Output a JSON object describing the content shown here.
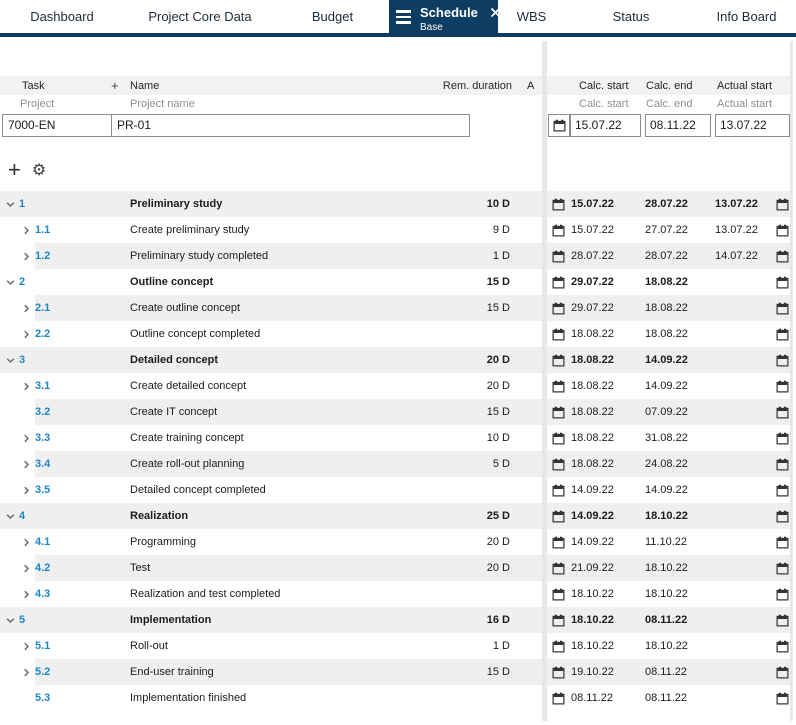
{
  "tabs": [
    {
      "label": "Dashboard"
    },
    {
      "label": "Project Core Data"
    },
    {
      "label": "Budget"
    },
    {
      "label": "Schedule",
      "subtitle": "Base",
      "active": true
    },
    {
      "label": "WBS"
    },
    {
      "label": "Status"
    },
    {
      "label": "Info Board"
    }
  ],
  "colors": {
    "accent_navy": "#0d3d62",
    "link_blue": "#1d87c4",
    "row_stripe": "#efefef",
    "header_bg": "#f2f2f2",
    "panel_separator": "#e8e5ed"
  },
  "icons": {
    "menu-icon": "≡",
    "close-icon": "×",
    "plus-icon": "+",
    "gear-icon": "⚙",
    "calendar-icon": "▦",
    "chevron-down-icon": "∨",
    "chevron-right-icon": "❯"
  },
  "grid": {
    "headers": {
      "task": "Task",
      "plus": "+",
      "name": "Name",
      "rem_duration": "Rem. duration",
      "a": "A",
      "calc_start": "Calc. start",
      "calc_end": "Calc. end",
      "actual_start": "Actual start"
    },
    "filters": {
      "task": "Project",
      "name": "Project name",
      "calc_start": "Calc. start",
      "calc_end": "Calc. end",
      "actual_start": "Actual start"
    },
    "project": {
      "task": "7000-EN",
      "name": "PR-01",
      "calc_start": "15.07.22",
      "calc_end": "08.11.22",
      "actual_start": "13.07.22"
    },
    "rows": [
      {
        "id": "1",
        "name": "Preliminary study",
        "duration": "10 D",
        "calc_start": "15.07.22",
        "calc_end": "28.07.22",
        "actual_start": "13.07.22",
        "level": 0,
        "chevron": "down",
        "bold": true
      },
      {
        "id": "1.1",
        "name": "Create preliminary study",
        "duration": "9 D",
        "calc_start": "15.07.22",
        "calc_end": "27.07.22",
        "actual_start": "13.07.22",
        "level": 1,
        "chevron": "right",
        "bold": false
      },
      {
        "id": "1.2",
        "name": "Preliminary study completed",
        "duration": "1 D",
        "calc_start": "28.07.22",
        "calc_end": "28.07.22",
        "actual_start": "14.07.22",
        "level": 1,
        "chevron": "right",
        "bold": false
      },
      {
        "id": "2",
        "name": "Outline concept",
        "duration": "15 D",
        "calc_start": "29.07.22",
        "calc_end": "18.08.22",
        "actual_start": "",
        "level": 0,
        "chevron": "down",
        "bold": true
      },
      {
        "id": "2.1",
        "name": "Create outline concept",
        "duration": "15 D",
        "calc_start": "29.07.22",
        "calc_end": "18.08.22",
        "actual_start": "",
        "level": 1,
        "chevron": "right",
        "bold": false
      },
      {
        "id": "2.2",
        "name": "Outline concept completed",
        "duration": "",
        "calc_start": "18.08.22",
        "calc_end": "18.08.22",
        "actual_start": "",
        "level": 1,
        "chevron": "right",
        "bold": false
      },
      {
        "id": "3",
        "name": "Detailed concept",
        "duration": "20 D",
        "calc_start": "18.08.22",
        "calc_end": "14.09.22",
        "actual_start": "",
        "level": 0,
        "chevron": "down",
        "bold": true
      },
      {
        "id": "3.1",
        "name": "Create detailed concept",
        "duration": "20 D",
        "calc_start": "18.08.22",
        "calc_end": "14.09.22",
        "actual_start": "",
        "level": 1,
        "chevron": "right",
        "bold": false
      },
      {
        "id": "3.2",
        "name": "Create IT concept",
        "duration": "15 D",
        "calc_start": "18.08.22",
        "calc_end": "07.09.22",
        "actual_start": "",
        "level": 1,
        "chevron": "none",
        "bold": false
      },
      {
        "id": "3.3",
        "name": "Create training concept",
        "duration": "10 D",
        "calc_start": "18.08.22",
        "calc_end": "31.08.22",
        "actual_start": "",
        "level": 1,
        "chevron": "right",
        "bold": false
      },
      {
        "id": "3.4",
        "name": "Create roll-out planning",
        "duration": "5 D",
        "calc_start": "18.08.22",
        "calc_end": "24.08.22",
        "actual_start": "",
        "level": 1,
        "chevron": "right",
        "bold": false
      },
      {
        "id": "3.5",
        "name": "Detailed concept completed",
        "duration": "",
        "calc_start": "14.09.22",
        "calc_end": "14.09.22",
        "actual_start": "",
        "level": 1,
        "chevron": "right",
        "bold": false
      },
      {
        "id": "4",
        "name": "Realization",
        "duration": "25 D",
        "calc_start": "14.09.22",
        "calc_end": "18.10.22",
        "actual_start": "",
        "level": 0,
        "chevron": "down",
        "bold": true
      },
      {
        "id": "4.1",
        "name": "Programming",
        "duration": "20 D",
        "calc_start": "14.09.22",
        "calc_end": "11.10.22",
        "actual_start": "",
        "level": 1,
        "chevron": "right",
        "bold": false
      },
      {
        "id": "4.2",
        "name": "Test",
        "duration": "20 D",
        "calc_start": "21.09.22",
        "calc_end": "18.10.22",
        "actual_start": "",
        "level": 1,
        "chevron": "right",
        "bold": false
      },
      {
        "id": "4.3",
        "name": "Realization and test completed",
        "duration": "",
        "calc_start": "18.10.22",
        "calc_end": "18.10.22",
        "actual_start": "",
        "level": 1,
        "chevron": "right",
        "bold": false
      },
      {
        "id": "5",
        "name": "Implementation",
        "duration": "16 D",
        "calc_start": "18.10.22",
        "calc_end": "08.11.22",
        "actual_start": "",
        "level": 0,
        "chevron": "down",
        "bold": true
      },
      {
        "id": "5.1",
        "name": "Roll-out",
        "duration": "1 D",
        "calc_start": "18.10.22",
        "calc_end": "18.10.22",
        "actual_start": "",
        "level": 1,
        "chevron": "right",
        "bold": false
      },
      {
        "id": "5.2",
        "name": "End-user training",
        "duration": "15 D",
        "calc_start": "19.10.22",
        "calc_end": "08.11.22",
        "actual_start": "",
        "level": 1,
        "chevron": "right",
        "bold": false
      },
      {
        "id": "5.3",
        "name": "Implementation finished",
        "duration": "",
        "calc_start": "08.11.22",
        "calc_end": "08.11.22",
        "actual_start": "",
        "level": 1,
        "chevron": "none",
        "bold": false
      }
    ]
  }
}
